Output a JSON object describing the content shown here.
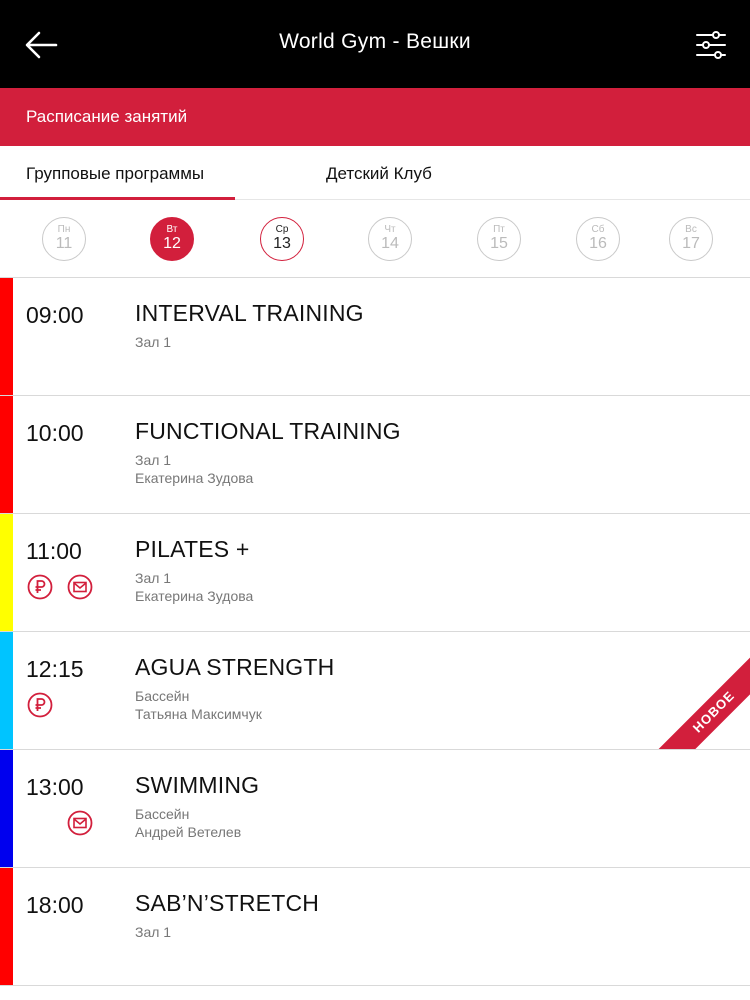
{
  "header": {
    "title": "World Gym - Вешки",
    "back_icon": "arrow-left-icon",
    "filter_icon": "sliders-icon"
  },
  "section": {
    "title": "Расписание занятий"
  },
  "tabs": [
    {
      "label": "Групповые программы",
      "active": true
    },
    {
      "label": "Детский Клуб",
      "active": false
    }
  ],
  "days": [
    {
      "weekday": "Пн",
      "num": "11",
      "state": "normal"
    },
    {
      "weekday": "Вт",
      "num": "12",
      "state": "selected"
    },
    {
      "weekday": "Ср",
      "num": "13",
      "state": "today"
    },
    {
      "weekday": "Чт",
      "num": "14",
      "state": "normal"
    },
    {
      "weekday": "Пт",
      "num": "15",
      "state": "normal"
    },
    {
      "weekday": "Сб",
      "num": "16",
      "state": "normal"
    },
    {
      "weekday": "Вс",
      "num": "17",
      "state": "normal"
    }
  ],
  "classes": [
    {
      "time": "09:00",
      "name": "INTERVAL TRAINING",
      "room": "Зал 1",
      "trainer": "",
      "color": "#ff0000",
      "icons": [],
      "badge": ""
    },
    {
      "time": "10:00",
      "name": "FUNCTIONAL TRAINING",
      "room": "Зал 1",
      "trainer": "Екатерина Зудова",
      "color": "#ff0000",
      "icons": [],
      "badge": ""
    },
    {
      "time": "11:00",
      "name": "PILATES +",
      "room": "Зал 1",
      "trainer": "Екатерина Зудова",
      "color": "#ffff00",
      "icons": [
        "ruble-icon",
        "mail-icon"
      ],
      "badge": ""
    },
    {
      "time": "12:15",
      "name": "AGUA STRENGTH",
      "room": "Бассейн",
      "trainer": "Татьяна Максимчук",
      "color": "#00c4ff",
      "icons": [
        "ruble-icon"
      ],
      "badge": "НОВОЕ"
    },
    {
      "time": "13:00",
      "name": "SWIMMING",
      "room": "Бассейн",
      "trainer": "Андрей Ветелев",
      "color": "#0000ee",
      "icons": [
        "mail-icon"
      ],
      "badge": ""
    },
    {
      "time": "18:00",
      "name": "SAB’N’STRETCH",
      "room": "Зал 1",
      "trainer": "",
      "color": "#ff0000",
      "icons": [],
      "badge": ""
    }
  ],
  "colors": {
    "accent": "#d21f3c",
    "topbar": "#000000"
  }
}
